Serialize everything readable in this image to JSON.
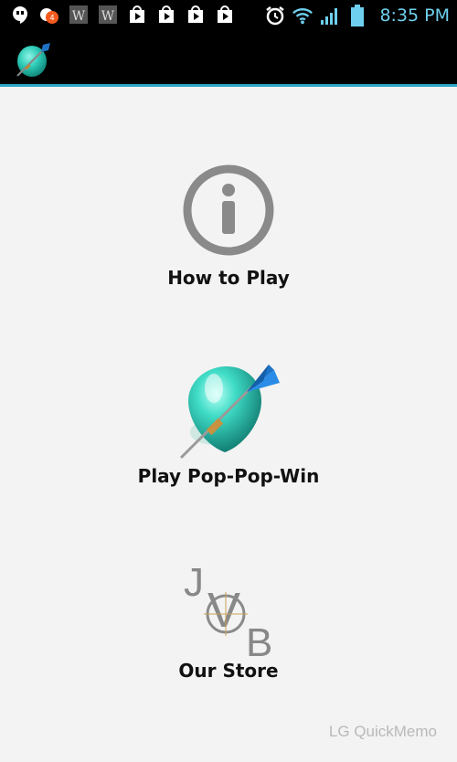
{
  "statusbar": {
    "time": "8:35 PM",
    "left_icons": [
      "hangouts-icon",
      "notification-badge-icon",
      "w-app-icon",
      "w-app-icon",
      "play-store-icon",
      "play-store-icon",
      "play-store-icon",
      "play-store-icon"
    ],
    "right_icons": [
      "alarm-icon",
      "wifi-icon",
      "signal-icon",
      "battery-icon"
    ]
  },
  "actionbar": {
    "logo": "balloon-dart-icon"
  },
  "menu": {
    "how_to_play": {
      "label": "How to Play",
      "icon": "info-icon"
    },
    "play": {
      "label": "Play Pop-Pop-Win",
      "icon": "balloon-dart-icon"
    },
    "store": {
      "label": "Our Store",
      "icon": "jvb-logo"
    }
  },
  "watermark": "LG QuickMemo",
  "colors": {
    "status_time": "#6ed0ee",
    "actionbar_bg": "#000000",
    "actionbar_accent": "#2aa6c8",
    "background": "#f3f3f3",
    "balloon": "#2bc9b5",
    "dart": "#1f74c8"
  }
}
